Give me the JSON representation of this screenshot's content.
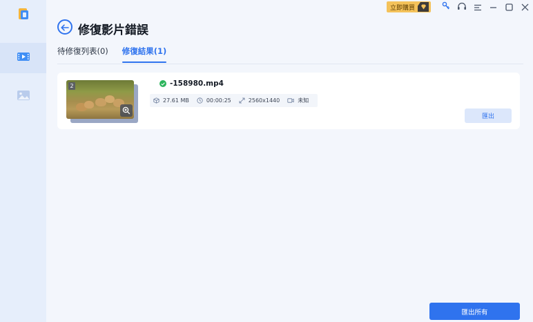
{
  "titlebar": {
    "buy_label": "立即購買",
    "icons": [
      "gem-icon",
      "key-icon",
      "headset-icon",
      "menu-icon",
      "minimize-icon",
      "maximize-icon",
      "close-icon"
    ]
  },
  "sidebar": {
    "items": [
      {
        "name": "app-logo",
        "icon": "app-logo-icon"
      },
      {
        "name": "video-repair",
        "icon": "video-icon",
        "active": true
      },
      {
        "name": "photo-repair",
        "icon": "photo-icon"
      }
    ]
  },
  "header": {
    "title": "修復影片錯誤"
  },
  "tabs": [
    {
      "label": "待修復列表(0)",
      "active": false
    },
    {
      "label": "修復結果(1)",
      "active": true
    }
  ],
  "result": {
    "thumb_index": "2",
    "status": "success",
    "file_name": "-158980.mp4",
    "size": "27.61 MB",
    "duration": "00:00:25",
    "resolution": "2560x1440",
    "codec": "未知",
    "export_label": "匯出"
  },
  "footer": {
    "export_all_label": "匯出所有"
  },
  "colors": {
    "accent": "#2f73ee",
    "success": "#2db55d",
    "buy_badge": "#f4c25a"
  }
}
